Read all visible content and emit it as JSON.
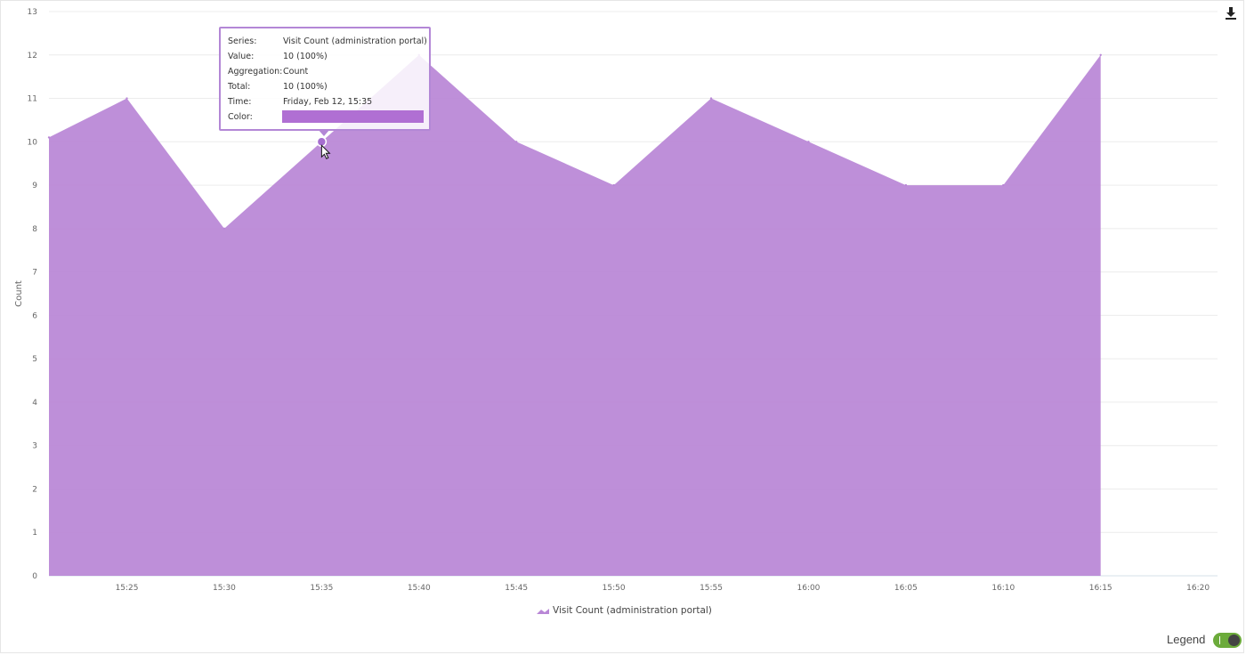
{
  "chart_data": {
    "type": "area",
    "ylabel": "Count",
    "ylim": [
      0,
      13
    ],
    "yticks": [
      0,
      1,
      2,
      3,
      4,
      5,
      6,
      7,
      8,
      9,
      10,
      11,
      12,
      13
    ],
    "xlim": [
      "15:21",
      "16:21"
    ],
    "xticks": [
      "15:25",
      "15:30",
      "15:35",
      "15:40",
      "15:45",
      "15:50",
      "15:55",
      "16:00",
      "16:05",
      "16:10",
      "16:15",
      "16:20"
    ],
    "grid": true,
    "legend_position": "bottom-center",
    "series": [
      {
        "name": "Visit Count (administration portal)",
        "color": "#b987d6",
        "x": [
          "15:21",
          "15:25",
          "15:30",
          "15:35",
          "15:40",
          "15:45",
          "15:50",
          "15:55",
          "16:00",
          "16:05",
          "16:10",
          "16:15"
        ],
        "values": [
          10.1,
          11,
          8,
          10,
          12,
          10,
          9,
          11,
          10,
          9,
          9,
          12
        ]
      }
    ]
  },
  "tooltip": {
    "rows": [
      {
        "key": "Series:",
        "value": "Visit Count (administration portal)"
      },
      {
        "key": "Value:",
        "value": "10 (100%)"
      },
      {
        "key": "Aggregation:",
        "value": "Count"
      },
      {
        "key": "Total:",
        "value": "10 (100%)"
      },
      {
        "key": "Time:",
        "value": "Friday, Feb 12, 15:35"
      },
      {
        "key": "Color:",
        "value": ""
      }
    ],
    "hover_time": "15:35",
    "swatch_color": "#b06fd3",
    "border_color": "#b387d6"
  },
  "controls": {
    "download_icon": "download-icon",
    "legend_toggle_label": "Legend",
    "legend_toggle_on": true,
    "toggle_color": "#6cab3b"
  }
}
